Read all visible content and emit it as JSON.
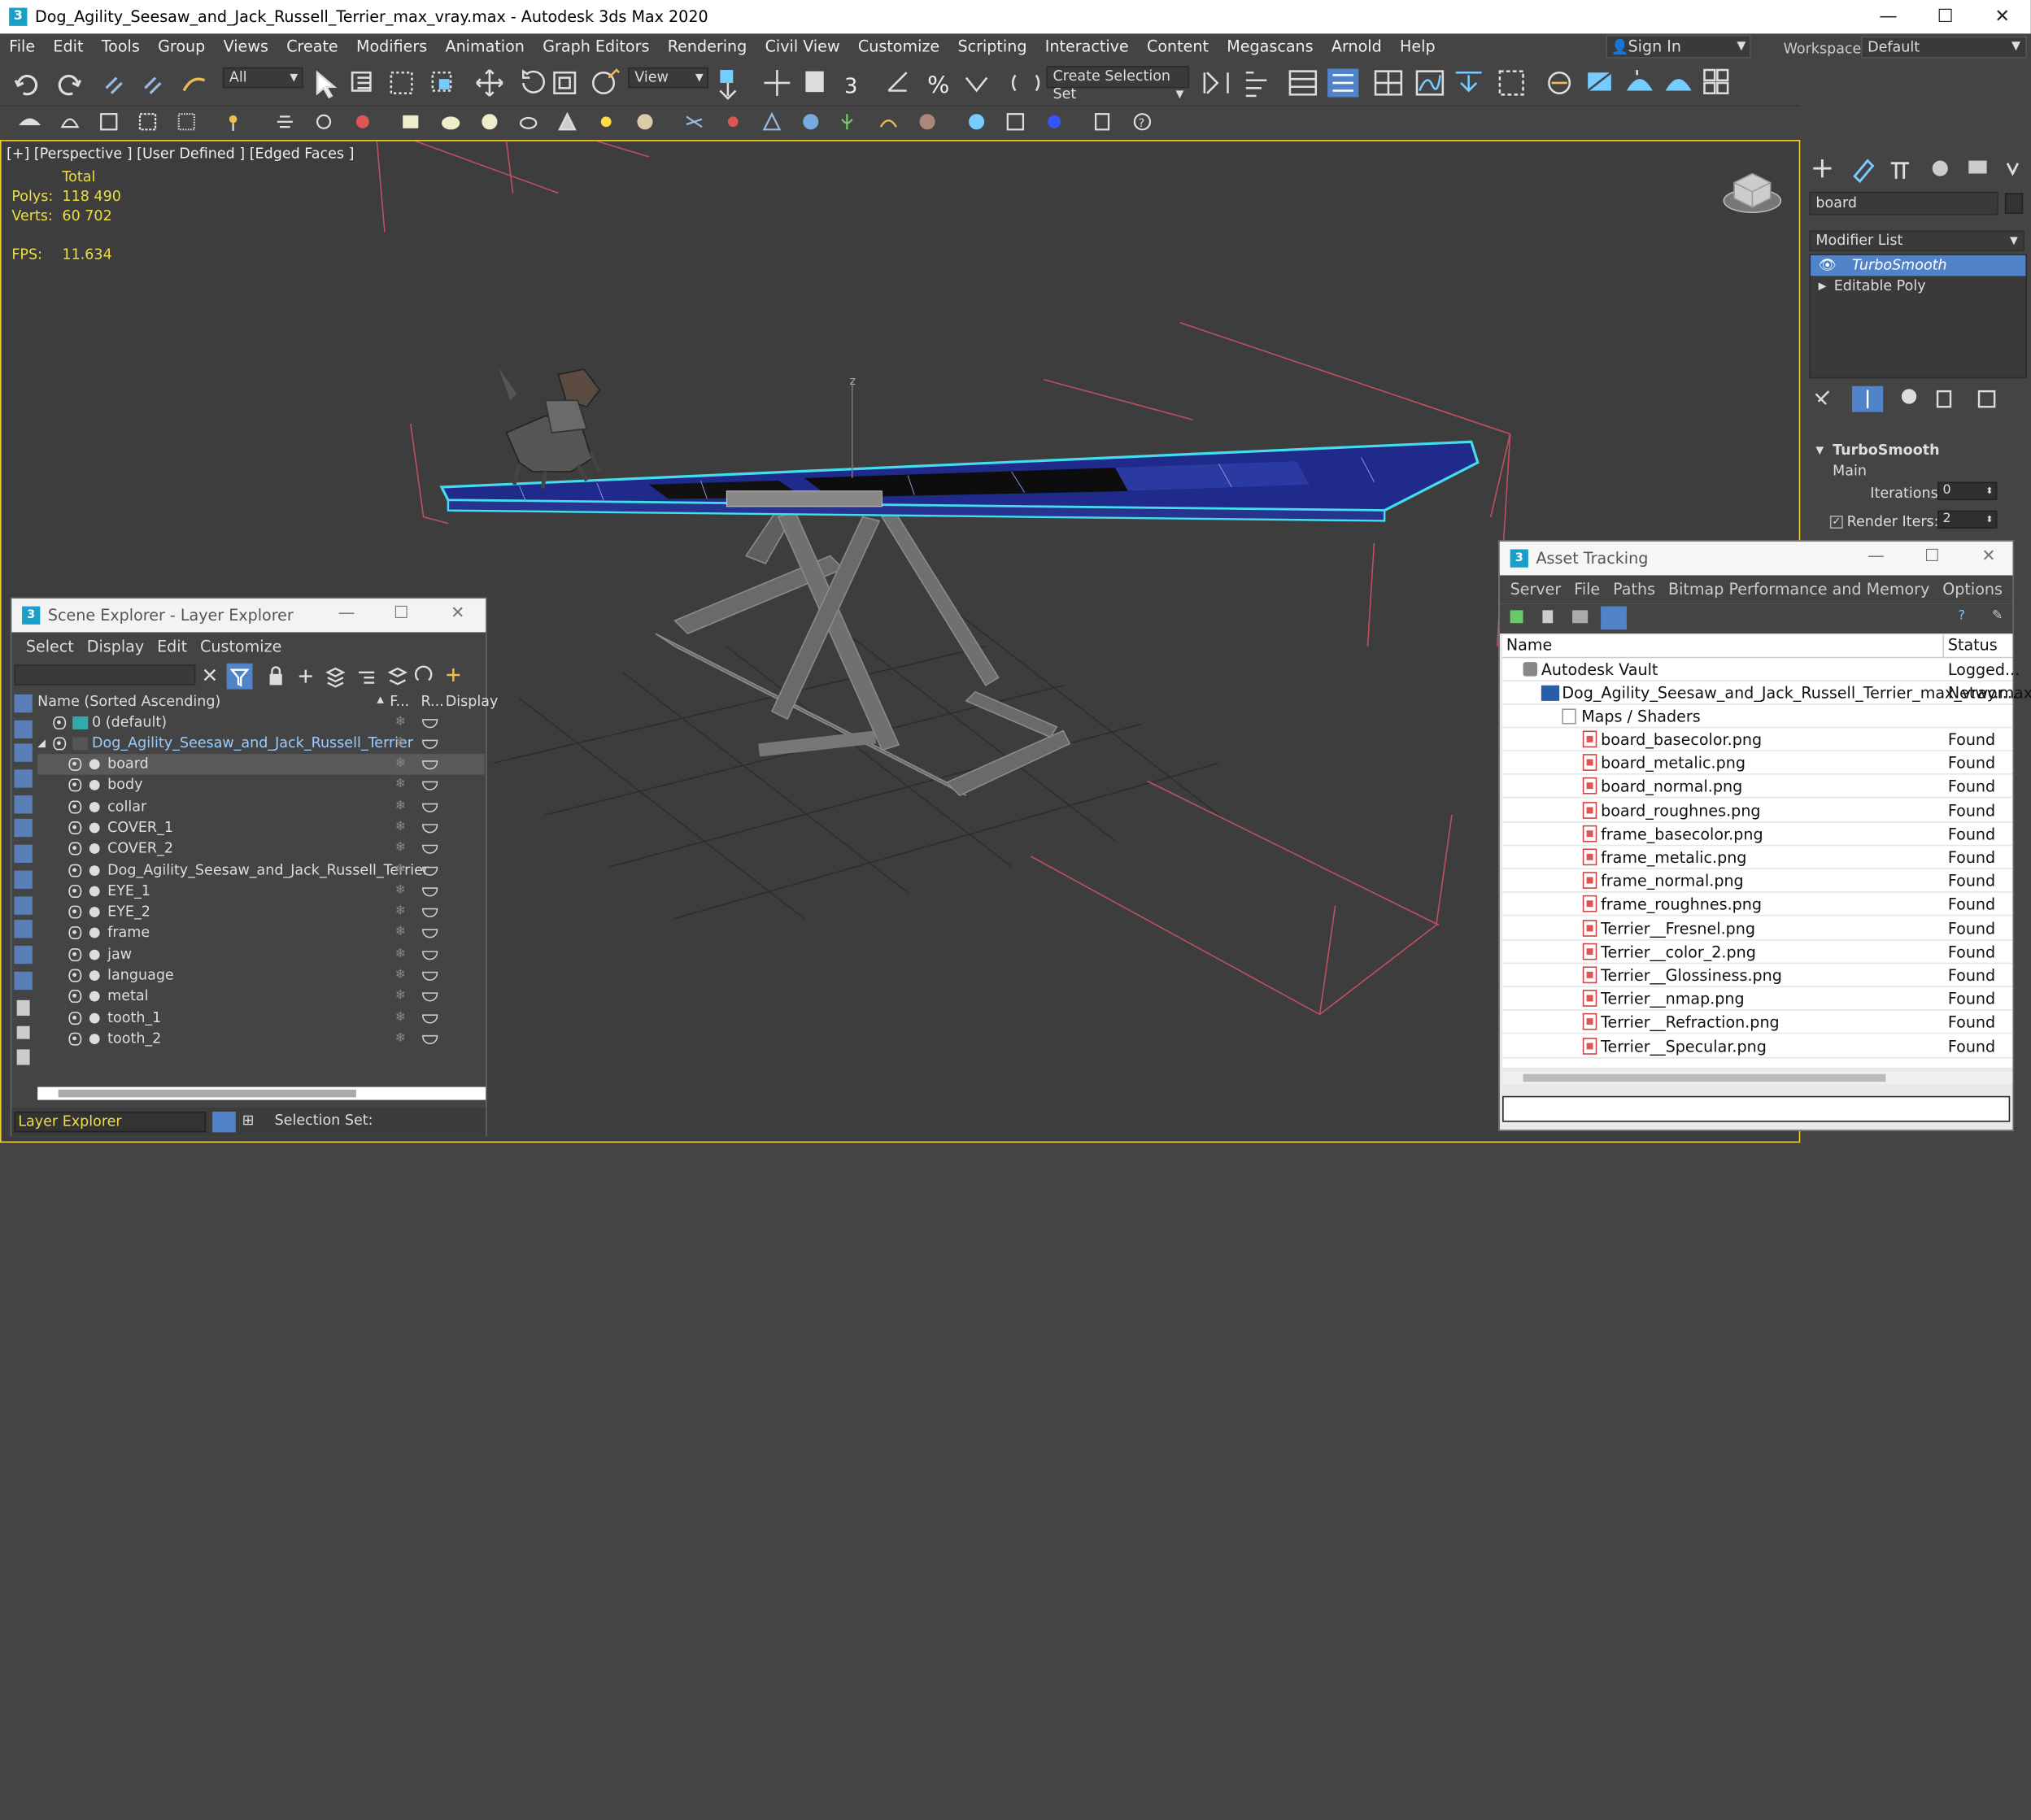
{
  "window": {
    "title": "Dog_Agility_Seesaw_and_Jack_Russell_Terrier_max_vray.max - Autodesk 3ds Max 2020",
    "minimize": "—",
    "maximize": "☐",
    "close": "✕"
  },
  "menubar": {
    "items": [
      "File",
      "Edit",
      "Tools",
      "Group",
      "Views",
      "Create",
      "Modifiers",
      "Animation",
      "Graph Editors",
      "Rendering",
      "Civil View",
      "Customize",
      "Scripting",
      "Interactive",
      "Content",
      "Megascans",
      "Arnold",
      "Help"
    ],
    "sign_in": "Sign In",
    "workspaces_label": "Workspaces:",
    "workspaces_value": "Default"
  },
  "toolbar": {
    "selection_filter": "All",
    "ref_coord": "View",
    "create_selection_set": "Create Selection Set"
  },
  "viewport": {
    "label": "[+] [Perspective ] [User Defined ] [Edged Faces ]",
    "stats_header": "Total",
    "polys_label": "Polys:",
    "polys_value": "118 490",
    "verts_label": "Verts:",
    "verts_value": "60 702",
    "fps_label": "FPS:",
    "fps_value": "11.634",
    "axis_z": "z"
  },
  "command_panel": {
    "object_name": "board",
    "modifier_list": "Modifier List",
    "stack": [
      "TurboSmooth",
      "Editable Poly"
    ],
    "rollout_title": "TurboSmooth",
    "section": "Main",
    "iterations_label": "Iterations:",
    "iterations_value": "0",
    "render_iters_label": "Render Iters:",
    "render_iters_value": "2"
  },
  "scene_explorer": {
    "title": "Scene Explorer - Layer Explorer",
    "menu": [
      "Select",
      "Display",
      "Edit",
      "Customize"
    ],
    "col_name": "Name (Sorted Ascending)",
    "col_f": "F...",
    "col_r": "R...",
    "col_display": "Display",
    "layers": [
      "0 (default)",
      "Dog_Agility_Seesaw_and_Jack_Russell_Terrier"
    ],
    "objects": [
      "board",
      "body",
      "collar",
      "COVER_1",
      "COVER_2",
      "Dog_Agility_Seesaw_and_Jack_Russell_Terrier",
      "EYE_1",
      "EYE_2",
      "frame",
      "jaw",
      "language",
      "metal",
      "tooth_1",
      "tooth_2"
    ],
    "footer_explorer": "Layer Explorer",
    "footer_selection_set": "Selection Set:"
  },
  "asset_tracking": {
    "title": "Asset Tracking",
    "menu": [
      "Server",
      "File",
      "Paths",
      "Bitmap Performance and Memory",
      "Options"
    ],
    "col_name": "Name",
    "col_status": "Status",
    "vault": "Autodesk Vault",
    "vault_status": "Logged...",
    "file": "Dog_Agility_Seesaw_and_Jack_Russell_Terrier_max_vray.max",
    "file_status": "Networ...",
    "group": "Maps / Shaders",
    "maps": [
      "board_basecolor.png",
      "board_metalic.png",
      "board_normal.png",
      "board_roughnes.png",
      "frame_basecolor.png",
      "frame_metalic.png",
      "frame_normal.png",
      "frame_roughnes.png",
      "Terrier__Fresnel.png",
      "Terrier__color_2.png",
      "Terrier__Glossiness.png",
      "Terrier__nmap.png",
      "Terrier__Refraction.png",
      "Terrier__Specular.png"
    ],
    "map_status": "Found"
  },
  "colors": {
    "accent": "#5083c8",
    "viewport_border": "#f0d030",
    "selection_highlight": "#44ddee"
  }
}
